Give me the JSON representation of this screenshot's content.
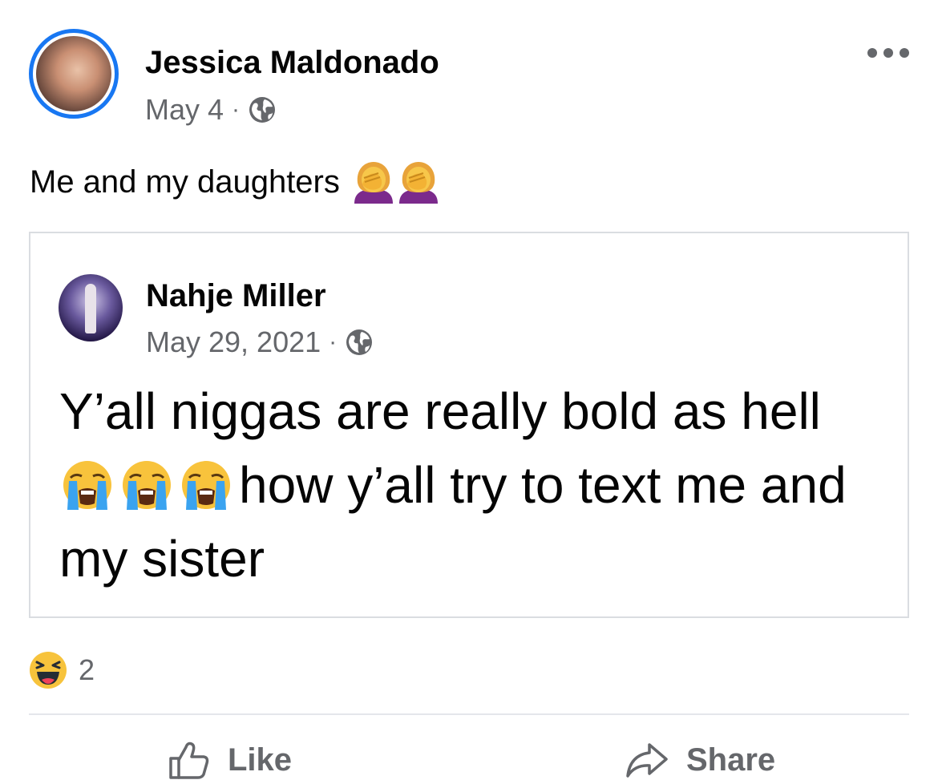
{
  "post": {
    "author": "Jessica Maldonado",
    "date": "May 4",
    "separator": "·",
    "audience_icon": "globe-icon",
    "menu_icon": "more-horizontal-icon",
    "text": "Me and my daughters",
    "text_emojis": [
      "woman-facepalming-emoji",
      "woman-facepalming-emoji"
    ]
  },
  "shared_post": {
    "author": "Nahje Miller",
    "date": "May 29, 2021",
    "separator": "·",
    "audience_icon": "globe-icon",
    "line1": "Y’all niggas are really bold as hell",
    "line2_emojis": [
      "loudly-crying-face-emoji",
      "loudly-crying-face-emoji",
      "loudly-crying-face-emoji"
    ],
    "line2": "how y’all try to text me and",
    "line3": "my sister"
  },
  "reactions": {
    "icon": "haha-reaction-icon",
    "count": "2"
  },
  "actions": {
    "like_label": "Like",
    "like_icon": "thumbs-up-icon",
    "share_label": "Share",
    "share_icon": "share-arrow-icon"
  },
  "colors": {
    "accent": "#1877f2",
    "secondary_text": "#65676b",
    "primary_text": "#050505",
    "border": "#dadde1",
    "divider": "#e4e6eb"
  }
}
